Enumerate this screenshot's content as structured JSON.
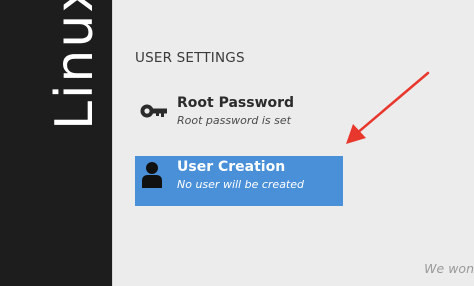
{
  "sidebar": {
    "brand_text": "Linux"
  },
  "section": {
    "title": "USER SETTINGS"
  },
  "spokes": [
    {
      "label": "Root Password",
      "status": "Root password is set",
      "icon": "key-icon"
    },
    {
      "label": "User Creation",
      "status": "No user will be created",
      "icon": "user-icon",
      "selected": true
    }
  ],
  "footer": {
    "note": "We won"
  },
  "colors": {
    "sidebar": "#1d1d1d",
    "background": "#ececec",
    "selected": "#4a90d9",
    "arrow": "#e8382e"
  }
}
